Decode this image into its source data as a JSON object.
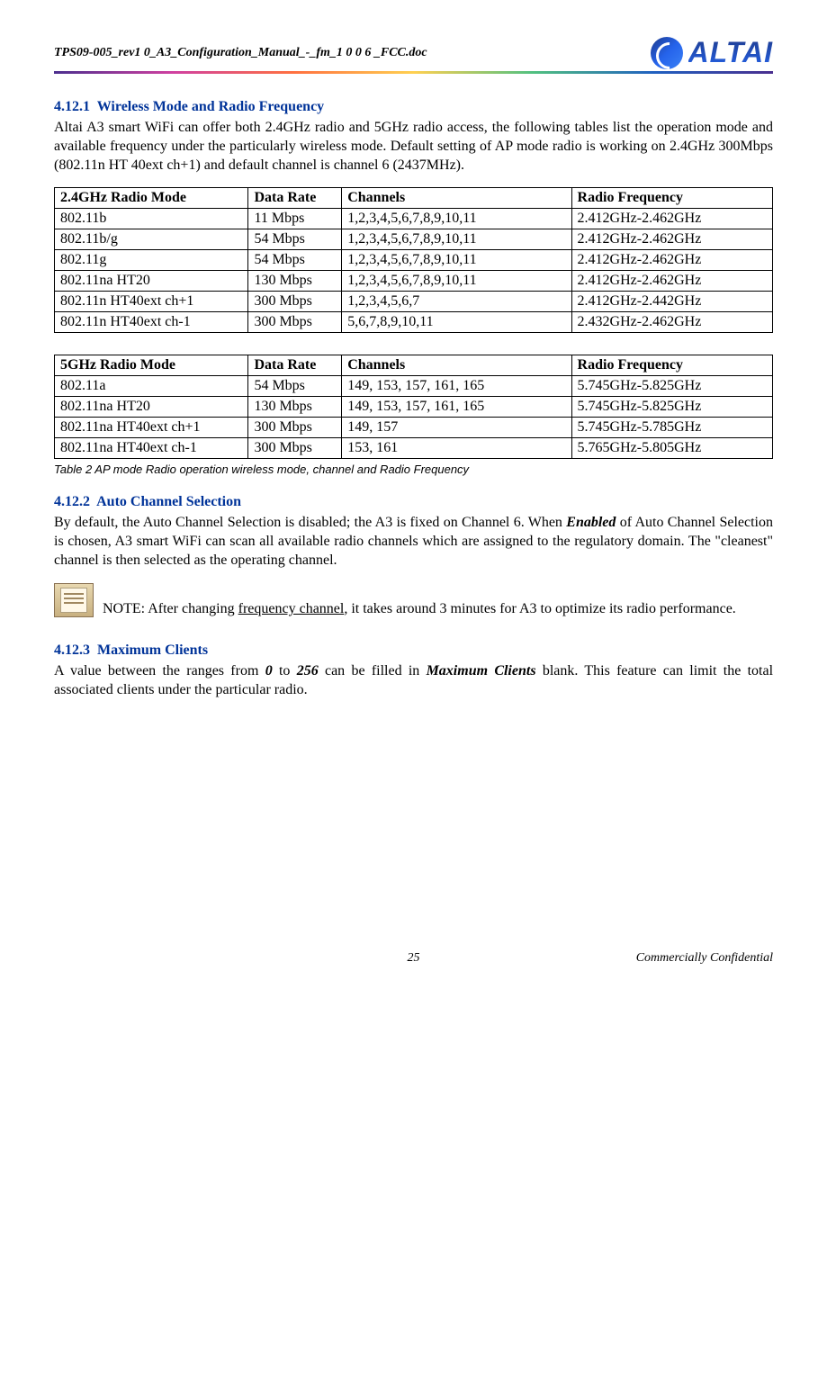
{
  "header": {
    "filename": "TPS09-005_rev1 0_A3_Configuration_Manual_-_fm_1 0 0 6 _FCC.doc",
    "logo_text": "ALTAI"
  },
  "sections": {
    "s1": {
      "num": "4.12.1",
      "title": "Wireless Mode and Radio Frequency",
      "p1": "Altai A3 smart WiFi can offer both 2.4GHz radio and 5GHz radio access, the following tables list the operation mode and available frequency under the particularly wireless mode. Default setting of AP mode radio is working on 2.4GHz 300Mbps (802.11n HT 40ext ch+1) and default channel is channel 6 (2437MHz)."
    },
    "s2": {
      "num": "4.12.2",
      "title": "Auto Channel Selection",
      "p1a": "By default, the Auto Channel Selection is disabled; the A3 is fixed on Channel 6. When ",
      "p1b": "Enabled",
      "p1c": " of Auto Channel Selection is chosen, A3 smart WiFi can scan all available radio channels which are assigned to the regulatory domain. The \"cleanest\" channel is then selected as the operating channel.",
      "note_a": " NOTE: After changing ",
      "note_b": "frequency channel",
      "note_c": ", it takes around 3 minutes for A3 to optimize its radio performance."
    },
    "s3": {
      "num": "4.12.3",
      "title": "Maximum Clients",
      "p1a": "A value between the ranges from ",
      "p1b": "0",
      "p1c": " to ",
      "p1d": "256",
      "p1e": " can be filled in ",
      "p1f": "Maximum Clients",
      "p1g": " blank. This feature can limit the total associated clients under the particular radio."
    }
  },
  "table1": {
    "h1": "2.4GHz Radio Mode",
    "h2": "Data Rate",
    "h3": "Channels",
    "h4": "Radio Frequency",
    "rows": [
      {
        "c1": "802.11b",
        "c2": "11 Mbps",
        "c3": "1,2,3,4,5,6,7,8,9,10,11",
        "c4": "2.412GHz-2.462GHz"
      },
      {
        "c1": "802.11b/g",
        "c2": "54 Mbps",
        "c3": "1,2,3,4,5,6,7,8,9,10,11",
        "c4": "2.412GHz-2.462GHz"
      },
      {
        "c1": "802.11g",
        "c2": "54 Mbps",
        "c3": "1,2,3,4,5,6,7,8,9,10,11",
        "c4": "2.412GHz-2.462GHz"
      },
      {
        "c1": "802.11na HT20",
        "c2": "130 Mbps",
        "c3": "1,2,3,4,5,6,7,8,9,10,11",
        "c4": "2.412GHz-2.462GHz"
      },
      {
        "c1": "802.11n HT40ext ch+1",
        "c2": "300 Mbps",
        "c3": "1,2,3,4,5,6,7",
        "c4": "2.412GHz-2.442GHz"
      },
      {
        "c1": "802.11n HT40ext ch-1",
        "c2": "300 Mbps",
        "c3": "5,6,7,8,9,10,11",
        "c4": "2.432GHz-2.462GHz"
      }
    ]
  },
  "table2": {
    "h1": "5GHz Radio Mode",
    "h2": "Data Rate",
    "h3": "Channels",
    "h4": "Radio Frequency",
    "rows": [
      {
        "c1": "802.11a",
        "c2": "54 Mbps",
        "c3": "149, 153, 157, 161, 165",
        "c4": "5.745GHz-5.825GHz"
      },
      {
        "c1": "802.11na HT20",
        "c2": "130 Mbps",
        "c3": "149, 153, 157, 161, 165",
        "c4": "5.745GHz-5.825GHz"
      },
      {
        "c1": "802.11na HT40ext ch+1",
        "c2": "300 Mbps",
        "c3": "149, 157",
        "c4": "5.745GHz-5.785GHz"
      },
      {
        "c1": "802.11na HT40ext ch-1",
        "c2": "300 Mbps",
        "c3": "153, 161",
        "c4": "5.765GHz-5.805GHz"
      }
    ]
  },
  "caption": "Table 2     AP mode Radio operation wireless mode, channel and Radio Frequency",
  "footer": {
    "page": "25",
    "confidential": "Commercially Confidential"
  }
}
